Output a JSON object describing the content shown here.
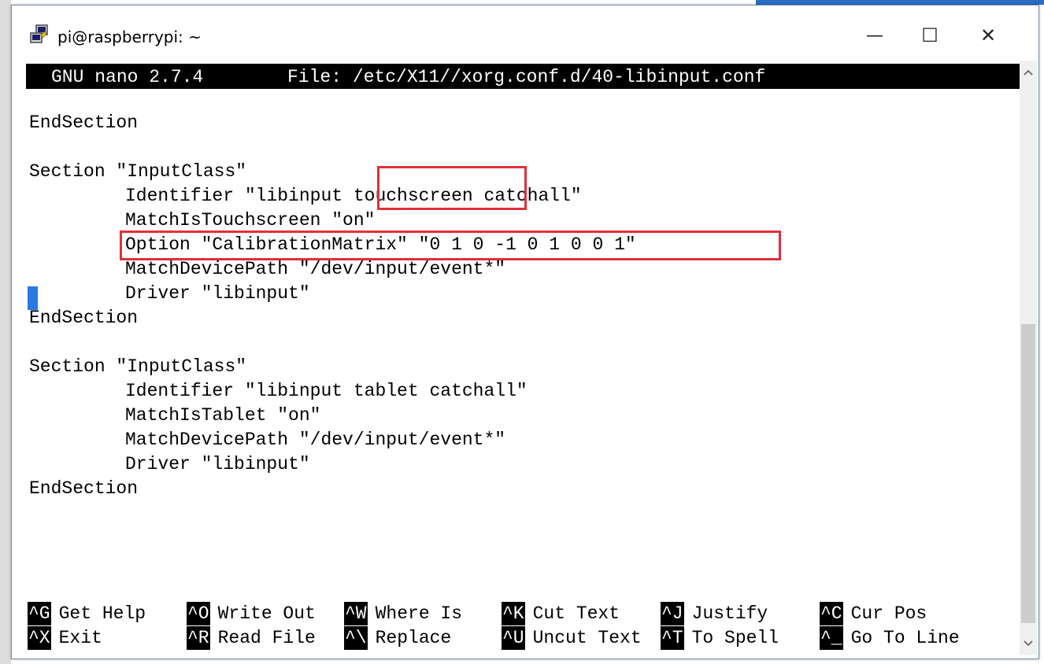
{
  "window": {
    "title": "pi@raspberrypi: ~",
    "minimize_glyph": "—",
    "maximize_glyph": "☐",
    "close_glyph": "✕"
  },
  "nano": {
    "version": "GNU nano 2.7.4",
    "file_label": "File: /etc/X11//xorg.conf.d/40-libinput.conf"
  },
  "lines": [
    "EndSection",
    "Section \"InputClass\"",
    "Identifier \"libinput touchscreen catchall\"",
    "MatchIsTouchscreen \"on\"",
    "Option \"CalibrationMatrix\" \"0 1 0 -1 0 1 0 0 1\"",
    "MatchDevicePath \"/dev/input/event*\"",
    "Driver \"libinput\"",
    "EndSection",
    "Section \"InputClass\"",
    "Identifier \"libinput tablet catchall\"",
    "MatchIsTablet \"on\"",
    "MatchDevicePath \"/dev/input/event*\"",
    "Driver \"libinput\"",
    "EndSection"
  ],
  "shortcuts": [
    {
      "key": "^G",
      "label": "Get Help"
    },
    {
      "key": "^O",
      "label": "Write Out"
    },
    {
      "key": "^W",
      "label": "Where Is"
    },
    {
      "key": "^K",
      "label": "Cut Text"
    },
    {
      "key": "^J",
      "label": "Justify"
    },
    {
      "key": "^C",
      "label": "Cur Pos"
    },
    {
      "key": "^X",
      "label": "Exit"
    },
    {
      "key": "^R",
      "label": "Read File"
    },
    {
      "key": "^\\",
      "label": "Replace"
    },
    {
      "key": "^U",
      "label": "Uncut Text"
    },
    {
      "key": "^T",
      "label": "To Spell"
    },
    {
      "key": "^_",
      "label": "Go To Line"
    }
  ],
  "colors": {
    "highlight": "#e0303a",
    "cursor": "#2a7ae2"
  },
  "icons": {
    "app": "putty-icon",
    "scroll_up": "chevron-up-icon",
    "scroll_down": "chevron-down-icon"
  }
}
